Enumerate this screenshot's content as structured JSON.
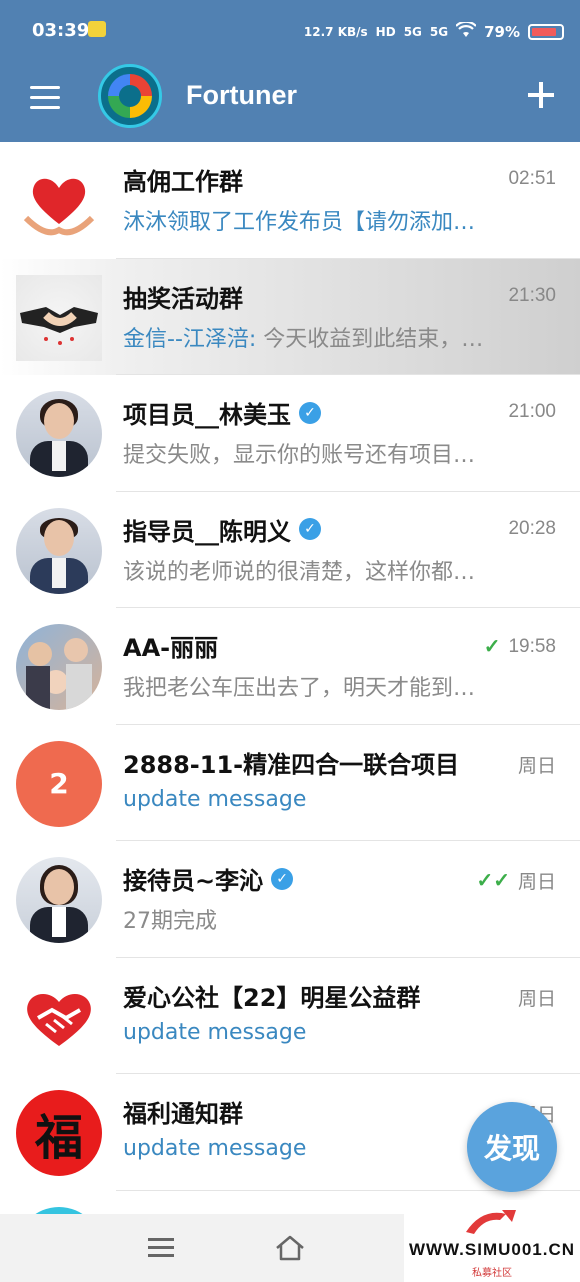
{
  "status_bar": {
    "time": "03:39",
    "net_speed": "12.7 KB/s",
    "hd": "HD",
    "signal1": "5G",
    "signal2": "5G",
    "battery": "79%"
  },
  "app_bar": {
    "title": "Fortuner",
    "menu_icon": "hamburger-icon",
    "add_icon": "plus-icon"
  },
  "chats": [
    {
      "name": "高佣工作群",
      "time": "02:51",
      "message": "沐沐领取了工作发布员【请勿添加…",
      "message_style": "blue",
      "avatar": "heart-hands"
    },
    {
      "name": "抽奖活动群",
      "time": "21:30",
      "sender": "金信--江泽涪:",
      "message": " 今天收益到此结束，…",
      "avatar": "handshake"
    },
    {
      "name": "项目员__林美玉",
      "time": "21:00",
      "message": "提交失败，显示你的账号还有项目…",
      "verified": true,
      "avatar": "woman-portrait"
    },
    {
      "name": "指导员__陈明义",
      "time": "20:28",
      "message": "该说的老师说的很清楚，这样你都…",
      "verified": true,
      "avatar": "man-portrait"
    },
    {
      "name": "AA-丽丽",
      "time": "19:58",
      "message": "我把老公车压出去了，明天才能到…",
      "read_status": "single-check",
      "avatar": "family-photo"
    },
    {
      "name": "2888-11-精准四合一联合项目",
      "time": "周日",
      "message": "update message",
      "message_style": "blue",
      "avatar_text": "2"
    },
    {
      "name": "接待员~李沁",
      "time": "周日",
      "message": "27期完成",
      "verified": true,
      "read_status": "double-check",
      "avatar": "woman-portrait-2"
    },
    {
      "name": "爱心公社【22】明星公益群",
      "time": "周日",
      "message": "update message",
      "message_style": "blue",
      "avatar": "heart-handshake"
    },
    {
      "name": "福利通知群",
      "time": "周日",
      "message": "update message",
      "message_style": "blue",
      "avatar_text": "福"
    }
  ],
  "fab": {
    "label": "发现"
  },
  "watermark": {
    "text": "WWW.SIMU001.CN",
    "sub": "私募社区"
  },
  "colors": {
    "header": "#5181b2",
    "accent": "#3a88c0",
    "check": "#3cae4a"
  }
}
